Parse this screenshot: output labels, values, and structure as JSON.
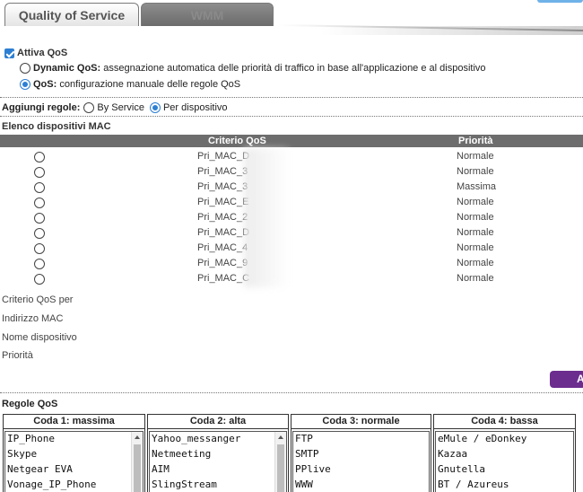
{
  "tabs": {
    "qos": "Quality of Service",
    "wmm": "WMM"
  },
  "qos_enable": {
    "label": "Attiva QoS",
    "checked": true
  },
  "dynamic": {
    "title": "Dynamic QoS:",
    "desc": " assegnazione automatica delle priorità di traffico in base all'applicazione e al dispositivo"
  },
  "manual": {
    "title": "QoS:",
    "desc": " configurazione manuale delle regole QoS"
  },
  "add_rules": {
    "label": "Aggiungi regole:",
    "by_service": "By Service",
    "per_device": "Per dispositivo"
  },
  "mac_list": {
    "title": "Elenco dispositivi MAC",
    "col_criteria": "Criterio QoS",
    "col_priority": "Priorità",
    "rows": [
      {
        "criteria": "Pri_MAC_D",
        "priority": "Normale"
      },
      {
        "criteria": "Pri_MAC_3",
        "priority": "Normale"
      },
      {
        "criteria": "Pri_MAC_3",
        "priority": "Massima"
      },
      {
        "criteria": "Pri_MAC_E",
        "priority": "Normale"
      },
      {
        "criteria": "Pri_MAC_2",
        "priority": "Normale"
      },
      {
        "criteria": "Pri_MAC_D",
        "priority": "Normale"
      },
      {
        "criteria": "Pri_MAC_4",
        "priority": "Normale"
      },
      {
        "criteria": "Pri_MAC_9",
        "priority": "Normale"
      },
      {
        "criteria": "Pri_MAC_C",
        "priority": "Normale"
      }
    ]
  },
  "form": {
    "criteria_for": "Criterio QoS per",
    "mac_address": "Indirizzo MAC",
    "device_name": "Nome dispositivo",
    "priority": "Priorità",
    "add_button": "A"
  },
  "rules": {
    "title": "Regole QoS",
    "queues": [
      {
        "name": "Coda 1: massima",
        "items": [
          "IP_Phone",
          "Skype",
          "Netgear EVA",
          "Vonage_IP_Phone"
        ],
        "scroll": true
      },
      {
        "name": "Coda 2: alta",
        "items": [
          "Yahoo_messanger",
          "Netmeeting",
          "AIM",
          "SlingStream"
        ],
        "scroll": true
      },
      {
        "name": "Coda 3: normale",
        "items": [
          "FTP",
          "SMTP",
          "PPlive",
          "WWW"
        ],
        "scroll": false
      },
      {
        "name": "Coda 4: bassa",
        "items": [
          "eMule / eDonkey",
          "Kazaa",
          "Gnutella",
          "BT / Azureus"
        ],
        "scroll": false
      }
    ]
  },
  "colors": {
    "accent": "#2d7fd3",
    "header": "#6d6d6d",
    "button": "#6b2d8e"
  }
}
